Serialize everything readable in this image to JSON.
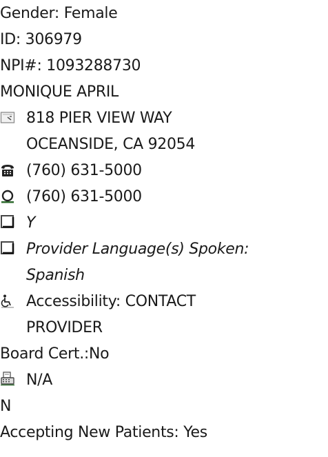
{
  "provider": {
    "gender": "Gender: Female",
    "id": "ID: 306979",
    "npi": "NPI#: 1093288730",
    "name": "MONIQUE APRIL",
    "address": {
      "line1": "818 PIER VIEW WAY",
      "line2": "OCEANSIDE, CA 92054"
    },
    "phone": "(760) 631-5000",
    "phone_alt": "(760) 631-5000",
    "checkbox_value": "Y",
    "languages": {
      "line1": "Provider Language(s) Spoken:",
      "line2": "Spanish"
    },
    "accessibility": {
      "line1": "Accessibility: CONTACT",
      "line2": "PROVIDER"
    },
    "board_cert": "Board Cert.:No",
    "fax": "N/A",
    "flag": "N",
    "accepting": "Accepting New Patients: Yes"
  },
  "icons": {
    "address": "address-card-icon",
    "phone": "telephone-icon",
    "phone_alt": "circle-phone-icon",
    "checkbox": "checkbox-icon",
    "languages": "checkbox-icon",
    "accessibility": "wheelchair-icon",
    "fax": "fax-icon"
  }
}
